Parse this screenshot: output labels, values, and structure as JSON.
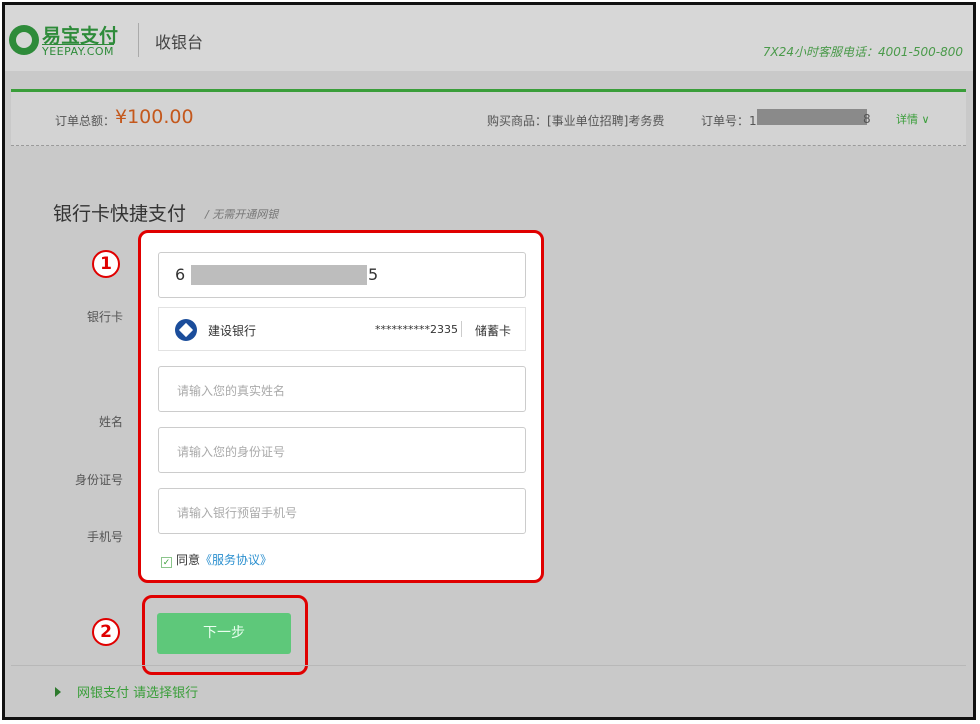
{
  "header": {
    "logo_cn": "易宝支付",
    "logo_en": "YEEPAY.COM",
    "title": "收银台",
    "hotline": "7X24小时客服电话：4001-500-800"
  },
  "order": {
    "amount_label": "订单总额：",
    "amount": "¥100.00",
    "goods": "购买商品：[事业单位招聘]考务费",
    "order_no_prefix": "订单号：1",
    "order_no_suffix": "8",
    "detail": "详情 ∨"
  },
  "section": {
    "title": "银行卡快捷支付",
    "note": "/ 无需开通网银"
  },
  "labels": {
    "card": "银行卡",
    "name": "姓名",
    "id": "身份证号",
    "phone": "手机号"
  },
  "form": {
    "card_start": "6",
    "card_end": "5",
    "bank_name": "建设银行",
    "bank_masked": "**********2335",
    "card_type": "储蓄卡",
    "name_placeholder": "请输入您的真实姓名",
    "id_placeholder": "请输入您的身份证号",
    "phone_placeholder": "请输入银行预留手机号",
    "agree_text": "同意",
    "agree_link": "《服务协议》"
  },
  "markers": {
    "one": "1",
    "two": "2"
  },
  "next_button": "下一步",
  "netbank": "网银支付 请选择银行",
  "colors": {
    "brand_green": "#3a9e3a",
    "amount_orange": "#c4581c",
    "callout_red": "#e00000"
  }
}
